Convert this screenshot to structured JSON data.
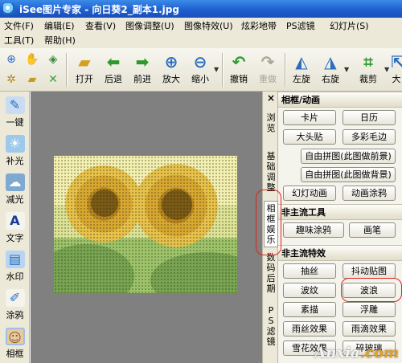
{
  "window": {
    "title": "iSee图片专家 - 向日葵2_副本1.jpg",
    "icon": "app-icon"
  },
  "menu": {
    "row1": [
      "文件(F)",
      "编辑(E)",
      "查看(V)",
      "图像调整(U)",
      "图像特效(U)",
      "炫彩地带",
      "PS滤镜",
      "幻灯片(S)"
    ],
    "row2": [
      "工具(T)",
      "帮助(H)"
    ]
  },
  "toolbar": {
    "small_icons": [
      "zoom-select-icon",
      "hand-icon",
      "capture-icon",
      "settings-icon",
      "folder-icon",
      "close-icon"
    ],
    "buttons": [
      {
        "label": "打开",
        "icon": "open-folder-icon"
      },
      {
        "label": "后退",
        "icon": "arrow-left-icon"
      },
      {
        "label": "前进",
        "icon": "arrow-right-icon"
      },
      {
        "label": "放大",
        "icon": "zoom-in-icon"
      },
      {
        "label": "缩小",
        "icon": "zoom-out-icon"
      },
      {
        "label": "撤销",
        "icon": "undo-icon"
      },
      {
        "label": "重做",
        "icon": "redo-icon"
      },
      {
        "label": "左旋",
        "icon": "rotate-left-icon"
      },
      {
        "label": "右旋",
        "icon": "rotate-right-icon"
      },
      {
        "label": "裁剪",
        "icon": "crop-icon"
      },
      {
        "label": "大",
        "icon": "resize-icon"
      }
    ]
  },
  "left_sidebar": [
    {
      "label": "一键",
      "icon": "one-click-icon"
    },
    {
      "label": "补光",
      "icon": "fill-light-icon"
    },
    {
      "label": "减光",
      "icon": "reduce-light-icon"
    },
    {
      "label": "文字",
      "icon": "text-icon"
    },
    {
      "label": "水印",
      "icon": "watermark-icon"
    },
    {
      "label": "涂鸦",
      "icon": "doodle-icon"
    },
    {
      "label": "相框",
      "icon": "frame-icon"
    }
  ],
  "side_tabs": {
    "close": "×",
    "items": [
      "浏览",
      "基础调整",
      "相框娱乐",
      "数码后期",
      "PS滤镜"
    ],
    "active": "相框娱乐"
  },
  "panel": {
    "sections": [
      {
        "title": "相框/动画",
        "buttons": [
          "卡片",
          "日历",
          "大头贴",
          "多彩毛边",
          "自由拼图(此图做前景)",
          "自由拼图(此图做背景)",
          "幻灯动画",
          "动画涂鸦"
        ]
      },
      {
        "title": "非主流工具",
        "buttons": [
          "趣味涂鸦",
          "画笔"
        ]
      },
      {
        "title": "非主流特效",
        "buttons": [
          "抽丝",
          "抖动贴图",
          "波纹",
          "波浪",
          "素描",
          "浮雕",
          "雨丝效果",
          "雨滴效果",
          "雪花效果",
          "碎玻璃"
        ]
      }
    ],
    "highlighted_button": "波浪"
  },
  "watermark": {
    "main": "Anxia",
    "accent": ".com"
  },
  "colors": {
    "titlebar": "#1f5fcf",
    "highlight": "#e0221a",
    "canvas_bg": "#808080"
  }
}
